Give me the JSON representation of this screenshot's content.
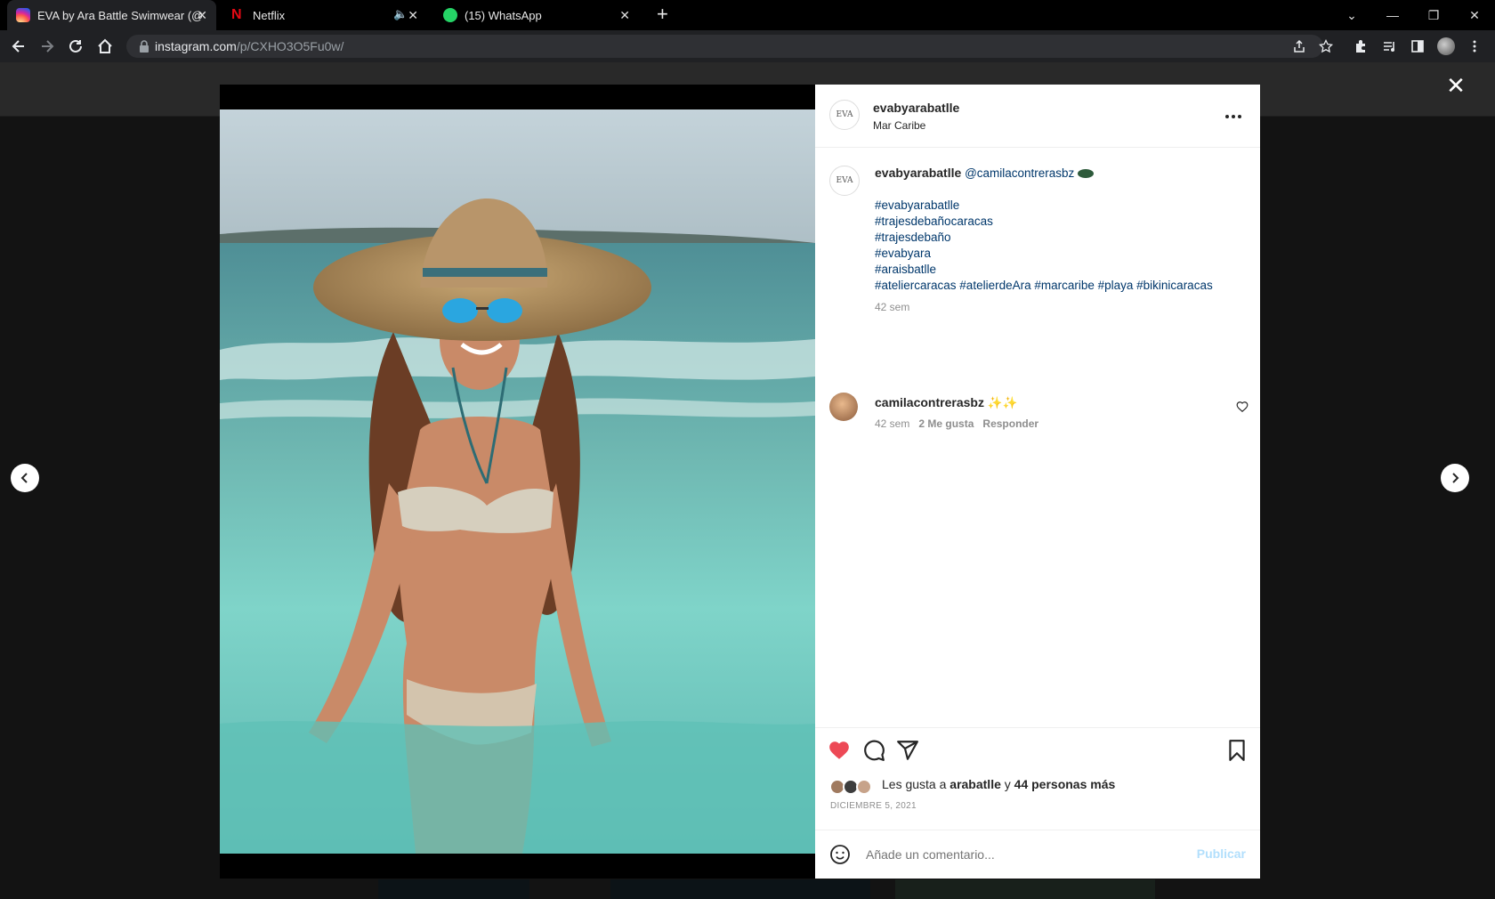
{
  "browser": {
    "tabs": [
      {
        "title": "EVA by Ara Battle Swimwear (@",
        "active": true
      },
      {
        "title": "Netflix",
        "active": false
      },
      {
        "title": "(15) WhatsApp",
        "active": false
      }
    ],
    "new_tab": "+",
    "url_host": "instagram.com",
    "url_path": "/p/CXHO3O5Fu0w/"
  },
  "post": {
    "account": "evabyarabatlle",
    "location": "Mar Caribe",
    "avatar_text": "EVA",
    "caption": {
      "user": "evabyarabatlle",
      "mention": "@camilacontrerasbz",
      "hashtags": [
        "#evabyarabatlle",
        "#trajesdebañocaracas",
        "#trajesdebaño",
        "#evabyara",
        "#araisbatlle"
      ],
      "last_line": "#ateliercaracas #atelierdeAra #marcaribe #playa #bikinicaracas",
      "time": "42 sem"
    },
    "comment": {
      "user": "camilacontrerasbz",
      "emoji": "✨✨",
      "time": "42 sem",
      "likes": "2 Me gusta",
      "reply": "Responder"
    },
    "likes": {
      "prefix": "Les gusta a",
      "user": "arabatlle",
      "connector": "y",
      "others": "44 personas más"
    },
    "date": "DICIEMBRE 5, 2021",
    "comment_placeholder": "Añade un comentario...",
    "publish": "Publicar"
  },
  "colors": {
    "like_red": "#ed4956",
    "link_blue": "#00376b",
    "publish_disabled": "#b2dffc"
  }
}
